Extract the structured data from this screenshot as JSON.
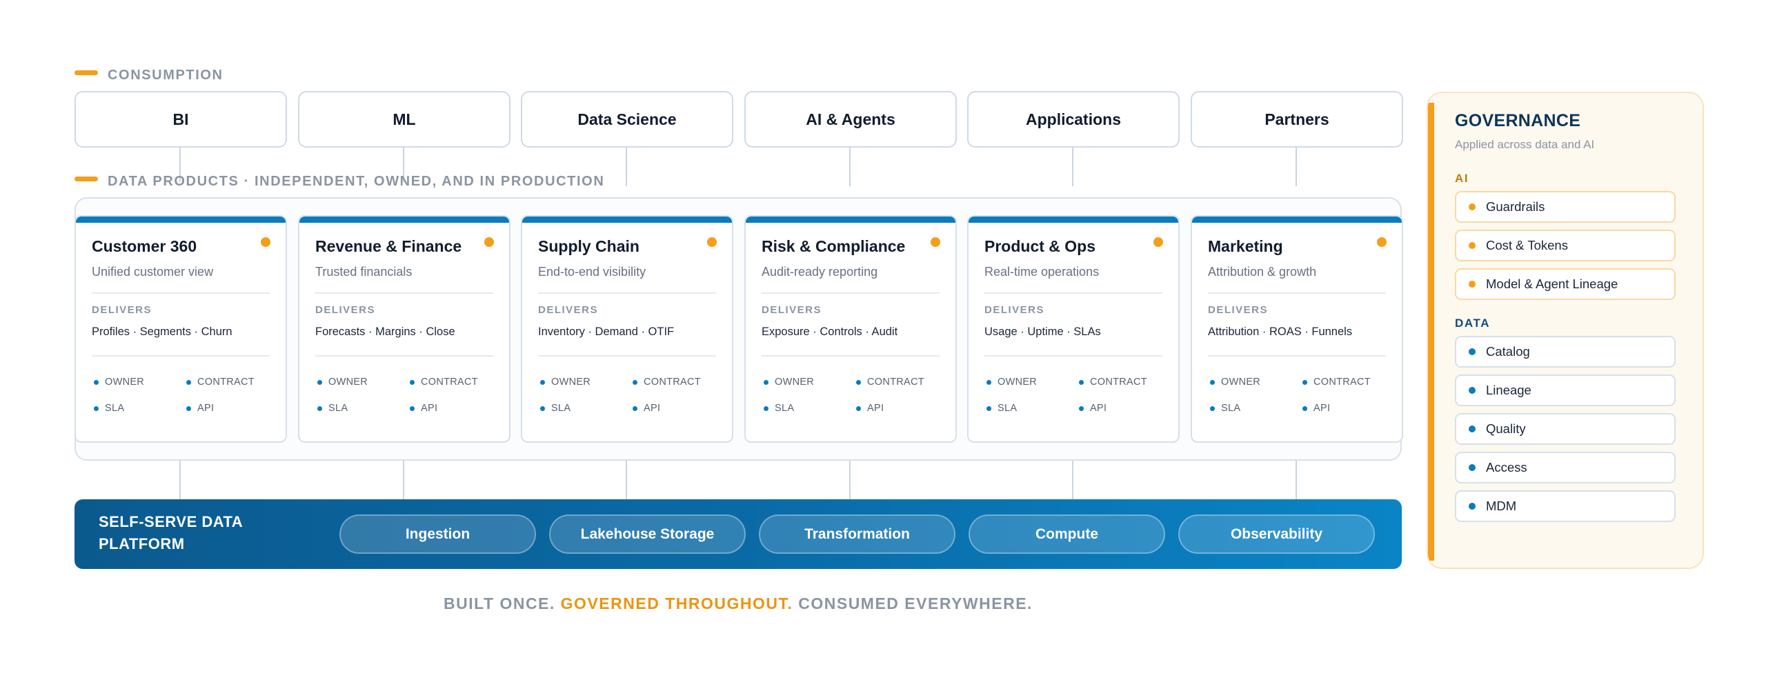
{
  "sections": {
    "consumption": "CONSUMPTION",
    "data_products": "DATA PRODUCTS · INDEPENDENT, OWNED, AND IN PRODUCTION"
  },
  "consumers": [
    "BI",
    "ML",
    "Data Science",
    "AI & Agents",
    "Applications",
    "Partners"
  ],
  "products": [
    {
      "title": "Customer 360",
      "subtitle": "Unified customer view",
      "delivers_label": "DELIVERS",
      "delivers": "Profiles · Segments · Churn"
    },
    {
      "title": "Revenue & Finance",
      "subtitle": "Trusted financials",
      "delivers_label": "DELIVERS",
      "delivers": "Forecasts · Margins · Close"
    },
    {
      "title": "Supply Chain",
      "subtitle": "End-to-end visibility",
      "delivers_label": "DELIVERS",
      "delivers": "Inventory · Demand · OTIF"
    },
    {
      "title": "Risk & Compliance",
      "subtitle": "Audit-ready reporting",
      "delivers_label": "DELIVERS",
      "delivers": "Exposure · Controls · Audit"
    },
    {
      "title": "Product & Ops",
      "subtitle": "Real-time operations",
      "delivers_label": "DELIVERS",
      "delivers": "Usage · Uptime · SLAs"
    },
    {
      "title": "Marketing",
      "subtitle": "Attribution & growth",
      "delivers_label": "DELIVERS",
      "delivers": "Attribution · ROAS · Funnels"
    }
  ],
  "product_tags": [
    "OWNER",
    "CONTRACT",
    "SLA",
    "API"
  ],
  "platform": {
    "title": "SELF-SERVE DATA PLATFORM",
    "capabilities": [
      "Ingestion",
      "Lakehouse Storage",
      "Transformation",
      "Compute",
      "Observability"
    ]
  },
  "tagline": {
    "part1": "BUILT ONCE.",
    "part2": "GOVERNED THROUGHOUT.",
    "part3": "CONSUMED EVERYWHERE."
  },
  "governance": {
    "title": "GOVERNANCE",
    "subtitle": "Applied across data and AI",
    "ai_label": "AI",
    "ai_items": [
      "Guardrails",
      "Cost & Tokens",
      "Model & Agent Lineage"
    ],
    "data_label": "DATA",
    "data_items": [
      "Catalog",
      "Lineage",
      "Quality",
      "Access",
      "MDM"
    ]
  },
  "colors": {
    "accent_orange": "#f59e1b",
    "accent_blue": "#0a7bbd",
    "text_dark": "#111c2e",
    "muted": "#8a95a3"
  }
}
